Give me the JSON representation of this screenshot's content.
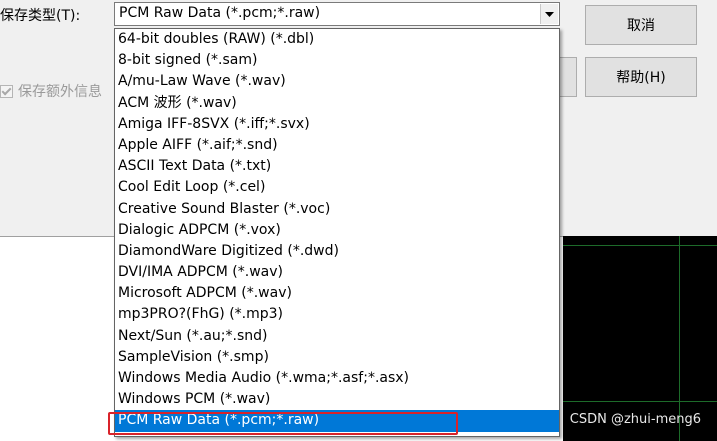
{
  "dialog": {
    "file_type_label": "保存类型(T):",
    "selected_type": "PCM Raw Data (*.pcm;*.raw)",
    "cancel_label": "取消",
    "help_label": "帮助(H)",
    "save_extra_info_label": "保存额外信息"
  },
  "dropdown": {
    "items": [
      "64-bit doubles (RAW) (*.dbl)",
      "8-bit signed (*.sam)",
      "A/mu-Law Wave (*.wav)",
      "ACM 波形 (*.wav)",
      "Amiga IFF-8SVX (*.iff;*.svx)",
      "Apple AIFF (*.aif;*.snd)",
      "ASCII Text Data (*.txt)",
      "Cool Edit Loop (*.cel)",
      "Creative Sound Blaster (*.voc)",
      "Dialogic ADPCM (*.vox)",
      "DiamondWare Digitized (*.dwd)",
      "DVI/IMA ADPCM (*.wav)",
      "Microsoft ADPCM (*.wav)",
      "mp3PRO?(FhG) (*.mp3)",
      "Next/Sun (*.au;*.snd)",
      "SampleVision (*.smp)",
      "Windows Media Audio (*.wma;*.asf;*.asx)",
      "Windows PCM (*.wav)",
      "PCM Raw Data (*.pcm;*.raw)"
    ],
    "selected_index": 18
  },
  "watermark": "CSDN @zhui-meng6",
  "colors": {
    "selection": "#0078d7",
    "highlight_box": "#d9232a",
    "dialog_bg": "#f0f0f0"
  }
}
